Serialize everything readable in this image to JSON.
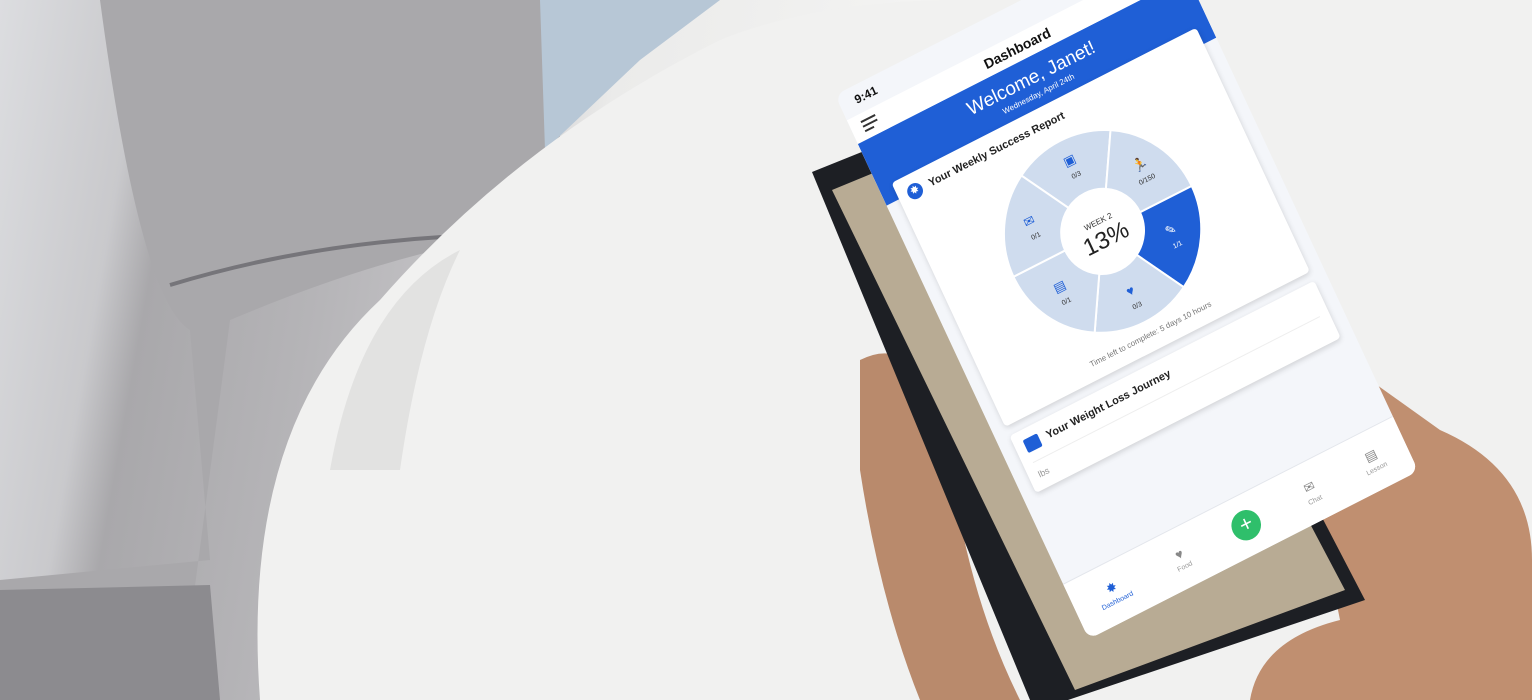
{
  "status": {
    "time": "9:41"
  },
  "nav": {
    "title": "Dashboard"
  },
  "welcome": {
    "greeting": "Welcome, Janet!",
    "date": "Wednesday, April 24th"
  },
  "weekly": {
    "title": "Your Weekly Success Report",
    "week_label": "WEEK 2",
    "percent": "13%",
    "segments": [
      {
        "icon": "scale-icon",
        "label": "0/3",
        "complete": false
      },
      {
        "icon": "running-icon",
        "label": "0/150",
        "complete": false
      },
      {
        "icon": "clipboard-icon",
        "label": "1/1",
        "complete": true
      },
      {
        "icon": "food-icon",
        "label": "0/3",
        "complete": false
      },
      {
        "icon": "book-icon",
        "label": "0/1",
        "complete": false
      },
      {
        "icon": "chat-icon",
        "label": "0/1",
        "complete": false
      }
    ],
    "time_left": "Time left to complete: 5 days 10 hours"
  },
  "journey": {
    "title": "Your Weight Loss Journey",
    "unit": "lbs"
  },
  "tabs": [
    {
      "label": "Dashboard",
      "icon": "dashboard-icon"
    },
    {
      "label": "Food",
      "icon": "food-icon"
    },
    {
      "label": "",
      "icon": "plus-icon"
    },
    {
      "label": "Chat",
      "icon": "chat-icon"
    },
    {
      "label": "Lesson",
      "icon": "lesson-icon"
    }
  ],
  "colors": {
    "accent": "#1f5fd6",
    "segment": "#cfdcee",
    "add": "#2fbf6b"
  }
}
